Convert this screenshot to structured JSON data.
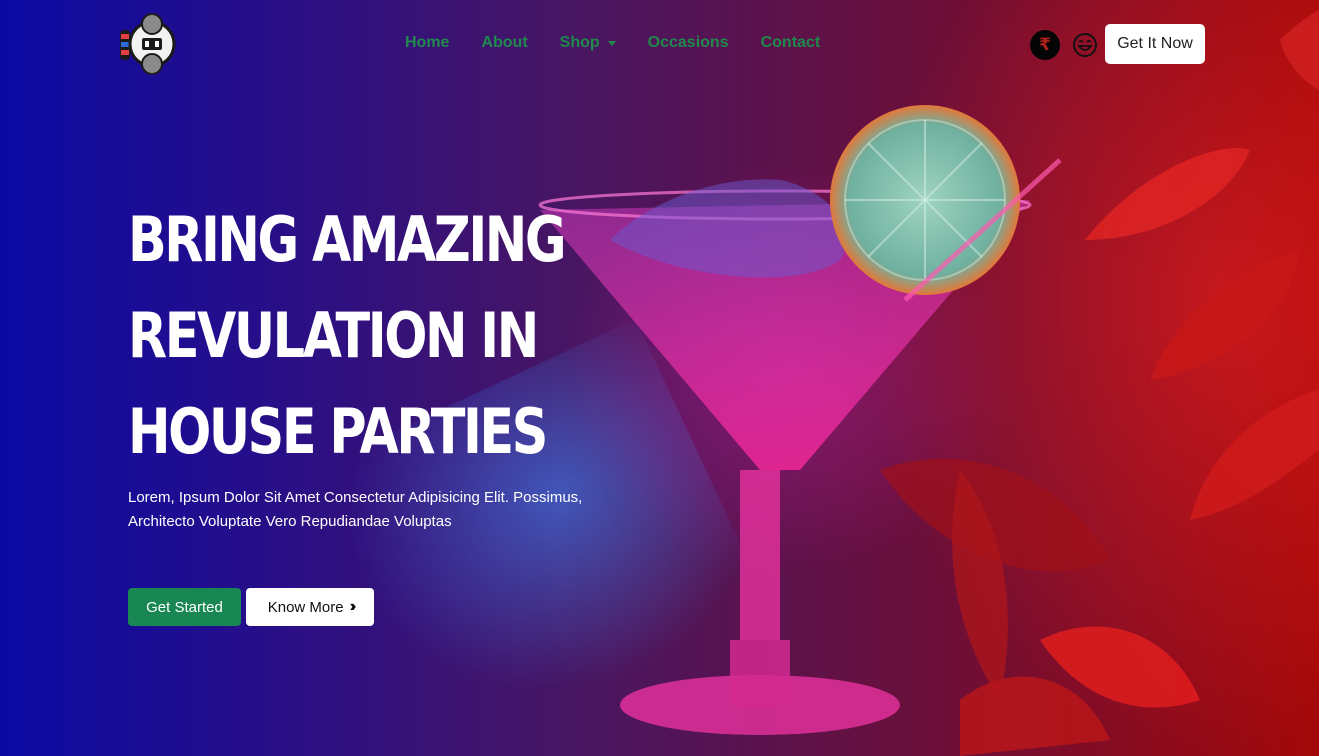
{
  "nav": {
    "logo_icon": "dj-robot-logo",
    "items": [
      {
        "label": "Home"
      },
      {
        "label": "About"
      },
      {
        "label": "Shop",
        "has_dropdown": true
      },
      {
        "label": "Occasions"
      },
      {
        "label": "Contact"
      }
    ],
    "currency_icon": "rupee-icon",
    "currency_symbol": "₹",
    "emoji_icon": "laughing-face-icon",
    "cta_label": "Get It Now",
    "link_color": "#1f8a4c"
  },
  "hero": {
    "headline_lines": [
      "BRING AMAZING",
      "REVULATION IN",
      "HOUSE PARTIES"
    ],
    "description_line1": "Lorem, Ipsum Dolor Sit Amet Consectetur Adipisicing Elit. Possimus,",
    "description_line2": "Architecto Voluptate Vero Repudiandae Voluptas",
    "primary_button": "Get Started",
    "secondary_button": "Know More",
    "secondary_icon": "double-chevron-right-icon",
    "primary_color": "#198754"
  }
}
